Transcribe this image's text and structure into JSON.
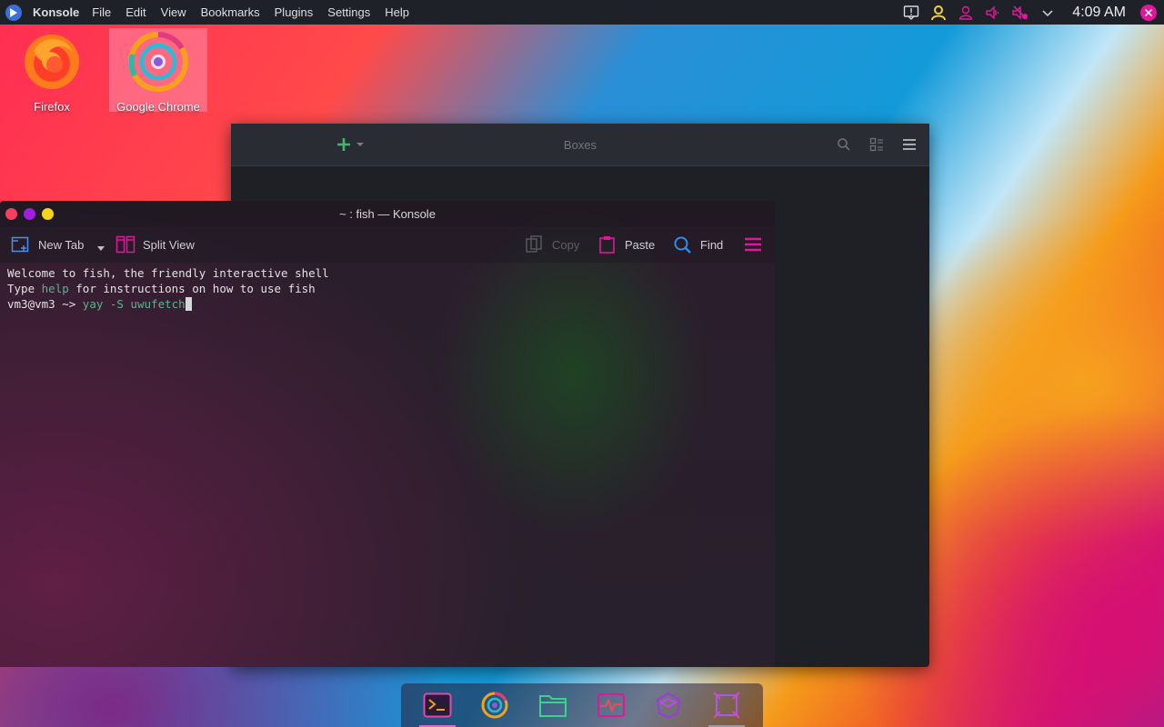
{
  "topbar": {
    "app_name": "Konsole",
    "menus": [
      "File",
      "Edit",
      "View",
      "Bookmarks",
      "Plugins",
      "Settings",
      "Help"
    ],
    "clock": "4:09 AM",
    "tray_icons": [
      "notification-icon",
      "user-icon",
      "user-outline-icon",
      "volume-icon",
      "mute-icon",
      "chevron-down-icon"
    ]
  },
  "desktop_icons": [
    {
      "label": "Firefox",
      "icon": "firefox-icon"
    },
    {
      "label": "Google Chrome",
      "icon": "chrome-icon"
    }
  ],
  "boxes_window": {
    "title": "Boxes"
  },
  "konsole": {
    "title": "~ : fish — Konsole",
    "toolbar": {
      "new_tab": "New Tab",
      "split_view": "Split View",
      "copy": "Copy",
      "paste": "Paste",
      "find": "Find"
    },
    "terminal": {
      "line1": "Welcome to fish, the friendly interactive shell",
      "line2_pre": "Type ",
      "line2_cmd": "help",
      "line2_post": " for instructions on how to use fish",
      "prompt": "vm3@vm3 ~> ",
      "command": "yay -S uwufetch"
    }
  },
  "dock": {
    "items": [
      "terminal-icon",
      "chrome-icon",
      "files-icon",
      "system-monitor-icon",
      "settings-icon",
      "screenshot-icon"
    ]
  },
  "colors": {
    "accent": "#e0179a",
    "panel": "#1f2128",
    "fish_highlight": "#5bb38a"
  }
}
